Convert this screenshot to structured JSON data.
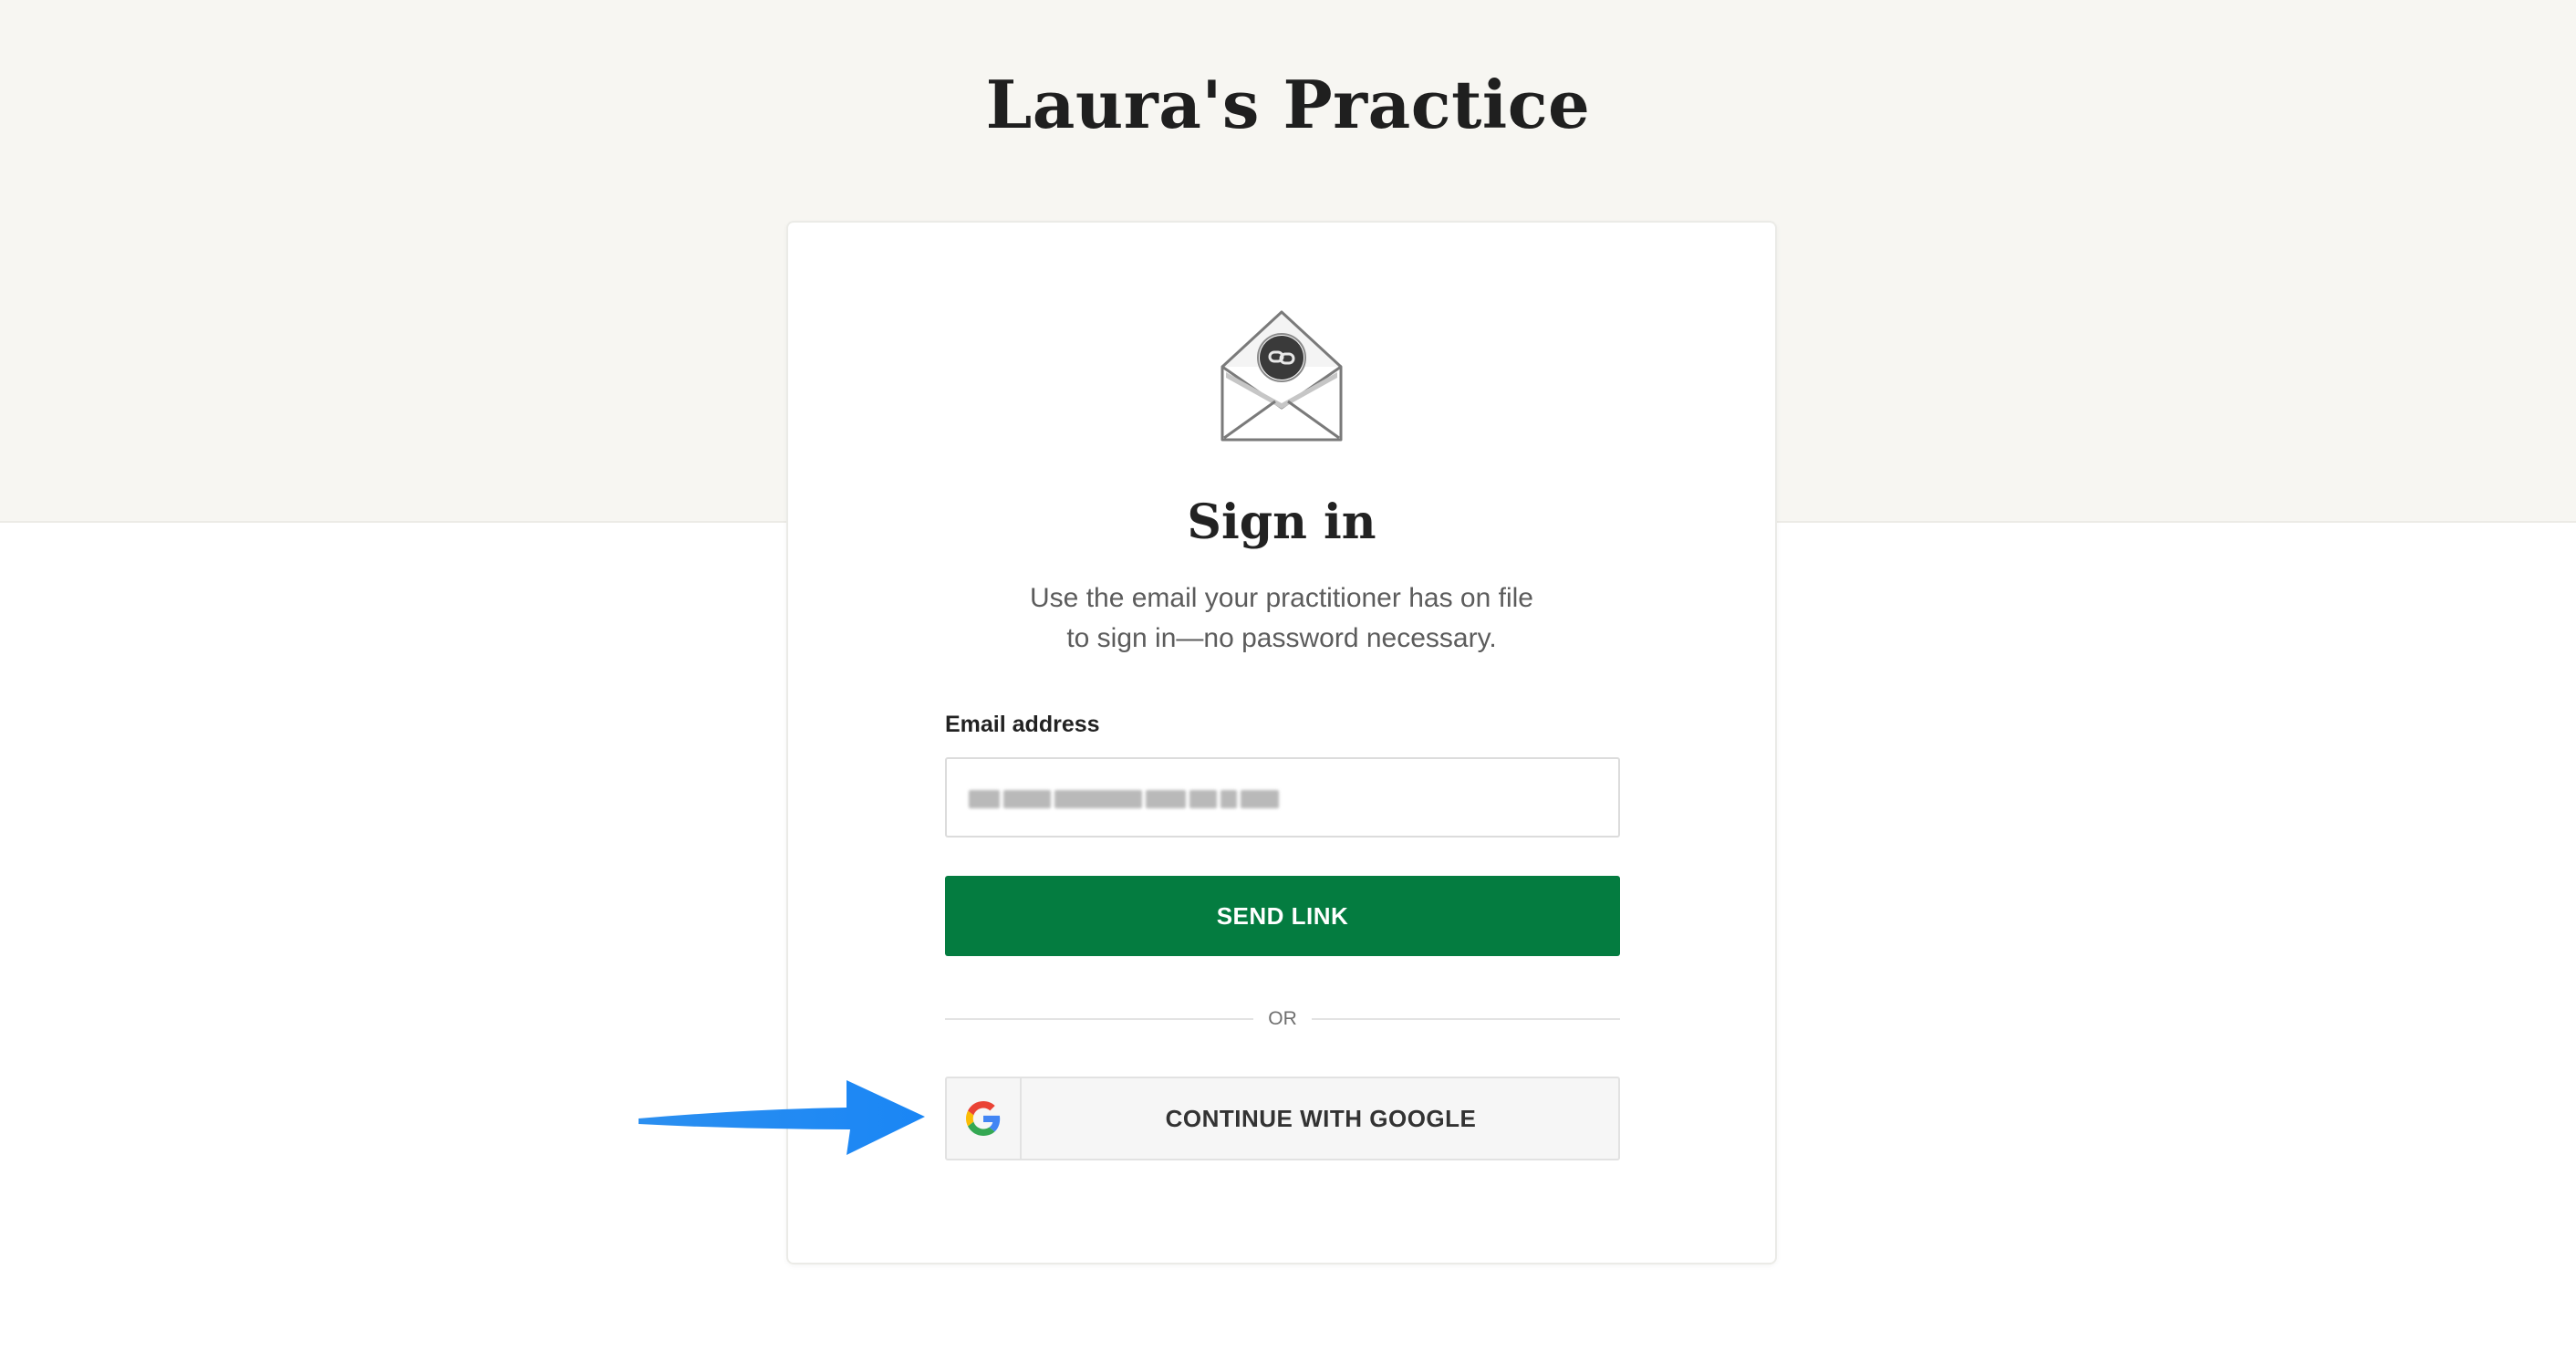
{
  "header": {
    "practice_name": "Laura's Practice"
  },
  "card": {
    "icon": "envelope-link-icon",
    "heading": "Sign in",
    "subtitle_line1": "Use the email your practitioner has on file",
    "subtitle_line2": "to sign in—no password necessary.",
    "email_label": "Email address",
    "send_button": "SEND LINK",
    "or_text": "OR",
    "google_button": "CONTINUE WITH GOOGLE",
    "google_icon": "google-g-icon"
  },
  "annotation": {
    "arrow_icon": "pointer-arrow-icon"
  },
  "colors": {
    "band_background": "#f7f6f2",
    "primary_green": "#047c40",
    "arrow_blue": "#1e90ff",
    "google_button_bg": "#f6f6f6"
  }
}
